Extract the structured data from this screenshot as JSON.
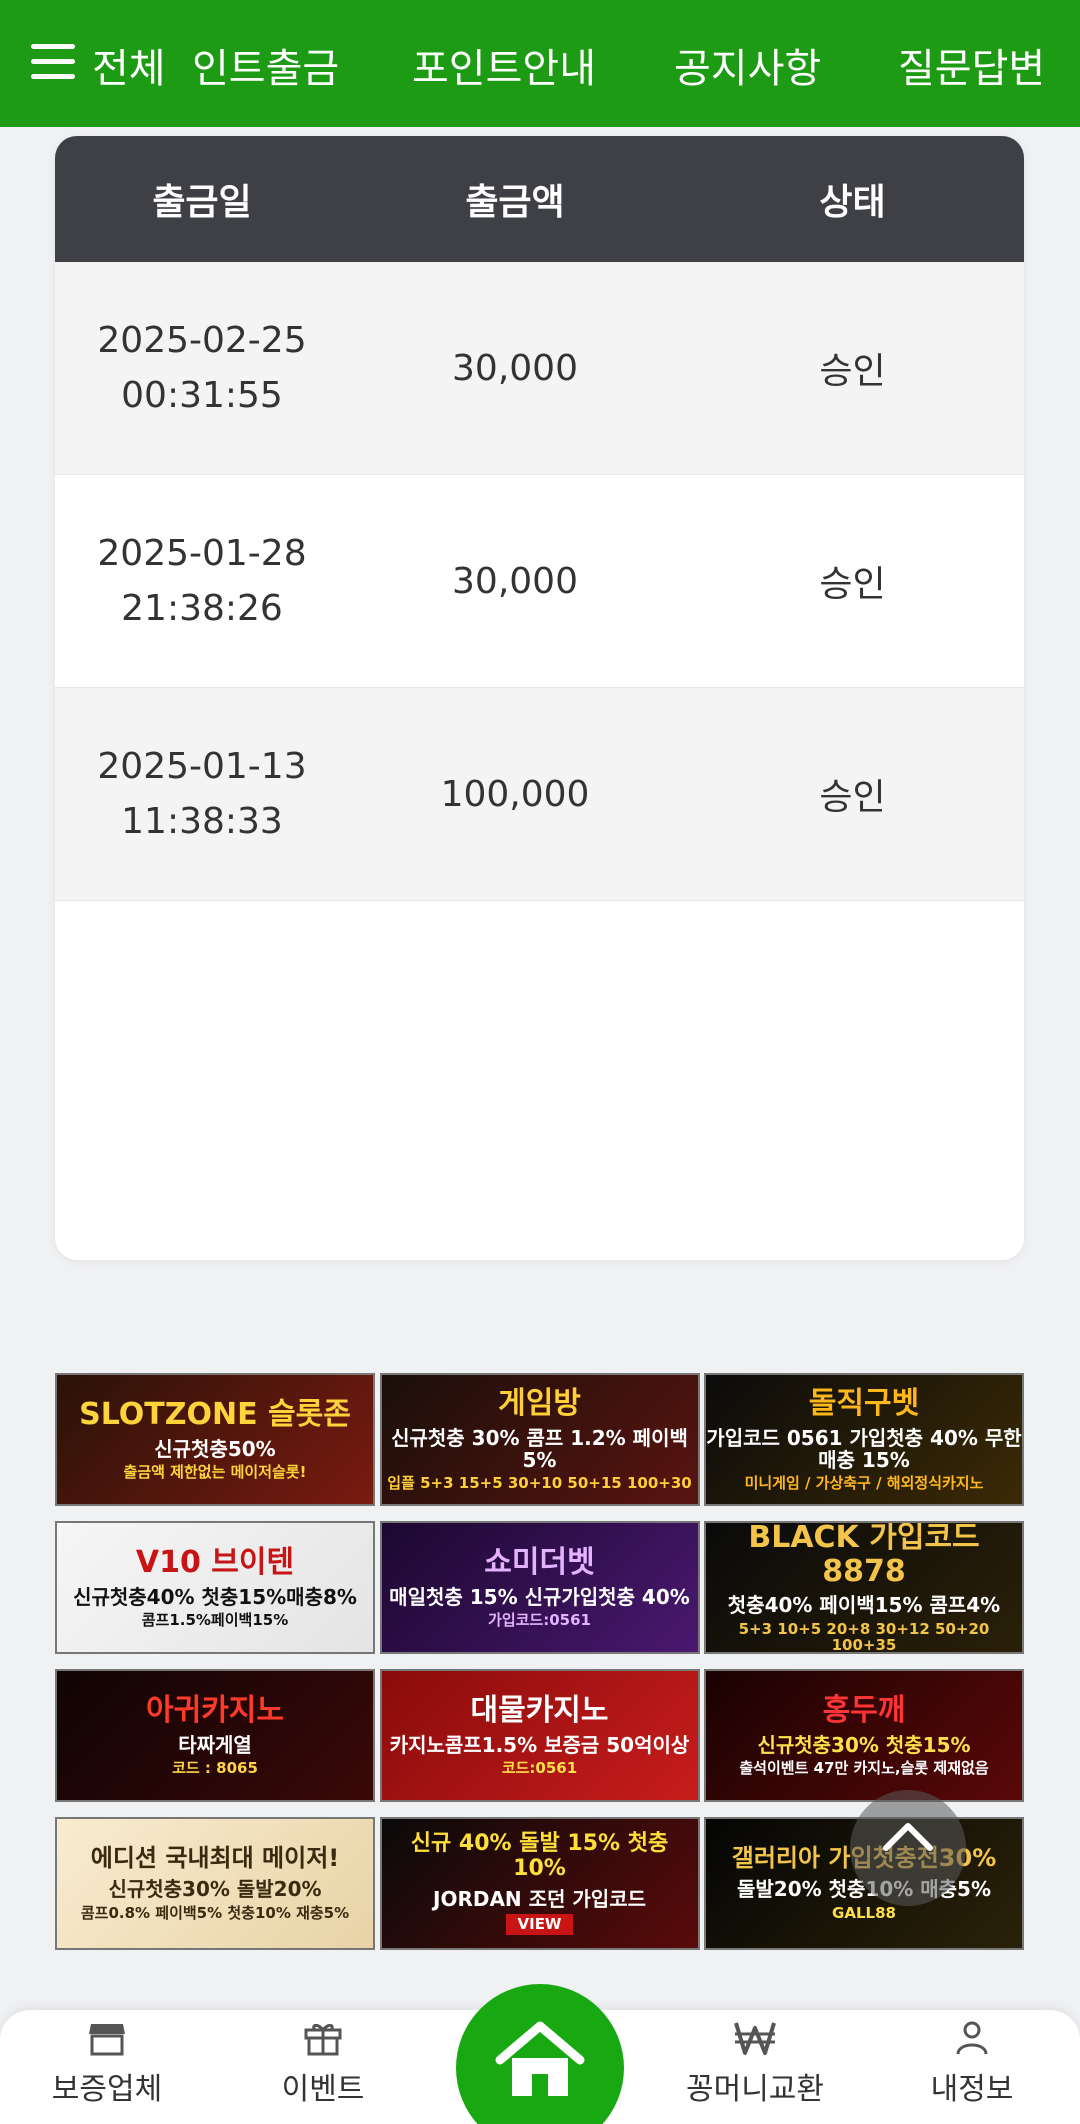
{
  "colors": {
    "brand_green": "#1e9b14",
    "table_header": "#3e4046",
    "home_green": "#18a812"
  },
  "topbar": {
    "menu_icon": "hamburger-menu-icon",
    "menu_label": "전체",
    "nav": [
      "인트출금",
      "포인트안내",
      "공지사항",
      "질문답변"
    ]
  },
  "withdrawals": {
    "headers": [
      "출금일",
      "출금액",
      "상태"
    ],
    "rows": [
      {
        "date": "2025-02-25",
        "time": "00:31:55",
        "amount": "30,000",
        "status": "승인"
      },
      {
        "date": "2025-01-28",
        "time": "21:38:26",
        "amount": "30,000",
        "status": "승인"
      },
      {
        "date": "2025-01-13",
        "time": "11:38:33",
        "amount": "100,000",
        "status": "승인"
      }
    ]
  },
  "banners": [
    {
      "title": "SLOTZONE 슬롯존",
      "line2": "신규첫충50%",
      "line3": "출금액 제한없는 메이저슬롯!"
    },
    {
      "title": "게임방",
      "line2": "신규첫충 30% 콤프 1.2% 페이백 5%",
      "line3": "입플 5+3 15+5 30+10 50+15 100+30"
    },
    {
      "title": "돌직구벳",
      "line2": "가입코드 0561 가입첫충 40% 무한매충 15%",
      "line3": "미니게임 / 가상축구 / 해외정식카지노"
    },
    {
      "title": "V10 브이텐",
      "line2": "신규첫충40% 첫충15%매충8%",
      "line3": "콤프1.5%페이백15%"
    },
    {
      "title": "쇼미더벳",
      "line2": "매일첫충 15% 신규가입첫충 40%",
      "line3": "가입코드:0561"
    },
    {
      "title": "BLACK 가입코드 8878",
      "line2": "첫충40% 페이백15% 콤프4%",
      "line3": "5+3 10+5 20+8 30+12 50+20 100+35"
    },
    {
      "title": "아귀카지노",
      "line2": "타짜게열",
      "line3": "코드 : 8065"
    },
    {
      "title": "대물카지노",
      "line2": "카지노콤프1.5% 보증금 50억이상",
      "line3": "코드:0561"
    },
    {
      "title": "홍두깨",
      "line2": "신규첫충30% 첫충15%",
      "line3": "출석이벤트 47만 카지노,슬롯 제재없음"
    },
    {
      "title": "에디션 국내최대 메이저!",
      "line2": "신규첫충30% 돌발20%",
      "line3": "콤프0.8% 페이백5% 첫충10% 재충5%"
    },
    {
      "title": "신규 40% 돌발 15% 첫충 10%",
      "line2": "JORDAN 조던 가입코드",
      "line3": "VIEW"
    },
    {
      "title": "갤러리아 가입첫충전30%",
      "line2": "돌발20% 첫충10% 매충5%",
      "line3": "GALL88"
    }
  ],
  "bottom_nav": {
    "items": [
      {
        "label": "보증업체",
        "icon": "store-icon"
      },
      {
        "label": "이벤트",
        "icon": "gift-icon"
      },
      {
        "label": "꽁머니교환",
        "icon": "won-icon"
      },
      {
        "label": "내정보",
        "icon": "user-icon"
      }
    ],
    "home_icon": "home-icon"
  }
}
